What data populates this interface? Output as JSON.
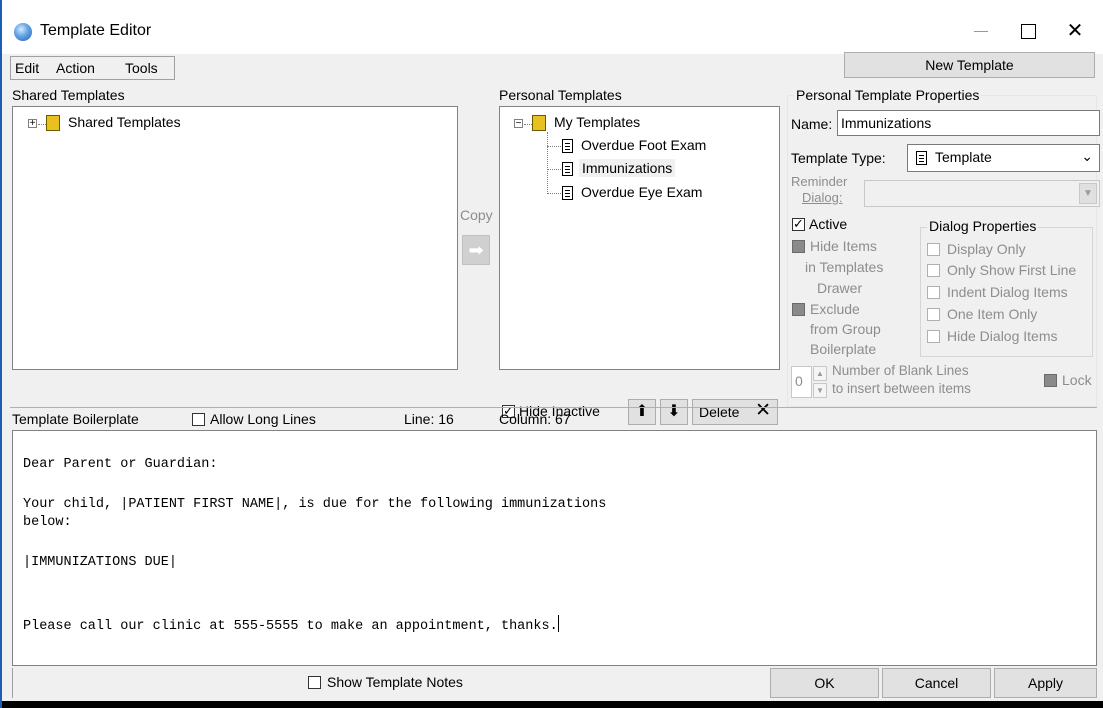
{
  "window": {
    "title": "Template Editor"
  },
  "menu": {
    "edit": "Edit",
    "action": "Action",
    "tools": "Tools"
  },
  "buttons": {
    "new_template": "New Template",
    "delete": "Delete",
    "ok": "OK",
    "cancel": "Cancel",
    "apply": "Apply"
  },
  "shared": {
    "header": "Shared Templates",
    "tree": [
      {
        "label": "Shared Templates",
        "expander": "+"
      }
    ]
  },
  "copy": {
    "label": "Copy"
  },
  "personal": {
    "header": "Personal Templates",
    "root": {
      "label": "My Templates",
      "expander": "−"
    },
    "items": [
      "Overdue Foot Exam",
      "Immunizations",
      "Overdue Eye Exam"
    ],
    "hide_inactive_label": "Hide Inactive"
  },
  "properties": {
    "group_title": "Personal Template Properties",
    "name_label": "Name:",
    "name_value": "Immunizations",
    "type_label": "Template Type:",
    "type_value": "Template",
    "reminder_label_1": "Reminder",
    "reminder_label_2": "Dialog:",
    "active_label": "Active",
    "hide_items_label": [
      "Hide Items",
      "in Templates",
      "Drawer"
    ],
    "exclude_label": [
      "Exclude",
      "from Group",
      "Boilerplate"
    ],
    "blank_lines_value": "0",
    "blank_lines_label": [
      "Number of Blank Lines",
      "to insert between items"
    ],
    "lock_label": "Lock",
    "dialog_props": {
      "title": "Dialog Properties",
      "options": [
        "Display Only",
        "Only Show First Line",
        "Indent Dialog Items",
        "One Item Only",
        "Hide Dialog Items"
      ]
    }
  },
  "boilerplate": {
    "label": "Template Boilerplate",
    "allow_long_lines": "Allow Long Lines",
    "line_status": "Line: 16",
    "column_status": "Column: 67",
    "lines": [
      "Dear Parent or Guardian:",
      "Your child, |PATIENT FIRST NAME|, is due for the following immunizations",
      "below:",
      "|IMMUNIZATIONS DUE|",
      "Please call our clinic at 555-5555 to make an appointment, thanks."
    ]
  },
  "footer": {
    "show_notes": "Show Template Notes"
  }
}
